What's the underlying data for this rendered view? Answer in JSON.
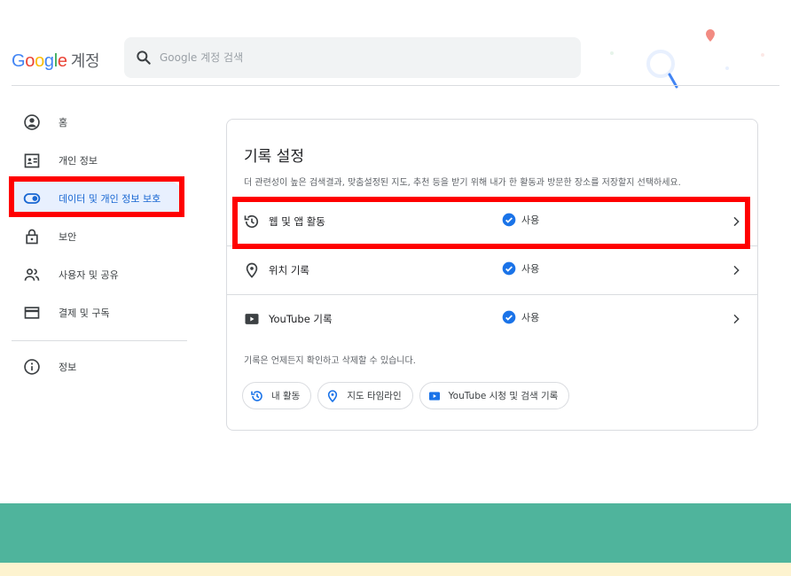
{
  "header": {
    "logo_letters": [
      "G",
      "o",
      "o",
      "g",
      "l",
      "e"
    ],
    "logo_suffix": "계정",
    "search_placeholder": "Google 계정 검색"
  },
  "sidebar": {
    "items": [
      {
        "label": "홈",
        "icon": "person-circle-icon",
        "active": false
      },
      {
        "label": "개인 정보",
        "icon": "id-card-icon",
        "active": false
      },
      {
        "label": "데이터 및 개인 정보 보호",
        "icon": "toggle-icon",
        "active": true
      },
      {
        "label": "보안",
        "icon": "lock-icon",
        "active": false
      },
      {
        "label": "사용자 및 공유",
        "icon": "people-icon",
        "active": false
      },
      {
        "label": "결제 및 구독",
        "icon": "credit-card-icon",
        "active": false
      },
      {
        "label": "정보",
        "icon": "info-icon",
        "active": false
      }
    ]
  },
  "history": {
    "title": "기록 설정",
    "description": "더 관련성이 높은 검색결과, 맞춤설정된 지도, 추천 등을 받기 위해 내가 한 활동과 방문한 장소를 저장할지 선택하세요.",
    "rows": [
      {
        "name": "웹 및 앱 활동",
        "status": "사용",
        "icon": "history-icon"
      },
      {
        "name": "위치 기록",
        "status": "사용",
        "icon": "location-pin-icon"
      },
      {
        "name": "YouTube 기록",
        "status": "사용",
        "icon": "youtube-icon"
      }
    ],
    "note": "기록은 언제든지 확인하고 삭제할 수 있습니다.",
    "chips": [
      {
        "label": "내 활동",
        "icon": "history-icon"
      },
      {
        "label": "지도 타임라인",
        "icon": "location-pin-icon"
      },
      {
        "label": "YouTube 시청 및 검색 기록",
        "icon": "youtube-icon"
      }
    ]
  },
  "colors": {
    "accent": "#1a73e8",
    "active_bg": "#e8f0fe",
    "highlight": "#ff0000",
    "band_green": "#4fb49c",
    "band_yellow": "#fdf3cf"
  }
}
